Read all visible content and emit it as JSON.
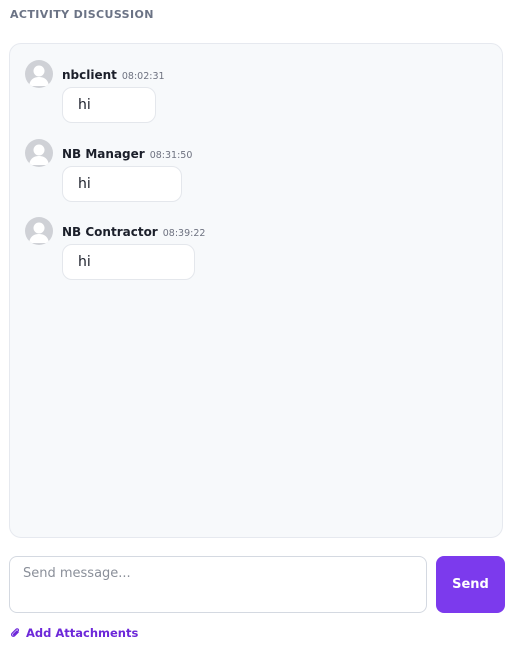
{
  "section_title": "ACTIVITY DISCUSSION",
  "messages": [
    {
      "author": "nbclient",
      "time": "08:02:31",
      "text": "hi"
    },
    {
      "author": "NB Manager",
      "time": "08:31:50",
      "text": "hi"
    },
    {
      "author": "NB Contractor",
      "time": "08:39:22",
      "text": "hi"
    }
  ],
  "composer": {
    "placeholder": "Send message...",
    "send_label": "Send",
    "attach_label": "Add Attachments"
  },
  "icons": {
    "avatar": "user-avatar-icon",
    "attachment": "paperclip-icon"
  },
  "colors": {
    "accent": "#7c3aed",
    "attach_text": "#6d28d9",
    "panel_bg": "#f7f9fb"
  }
}
